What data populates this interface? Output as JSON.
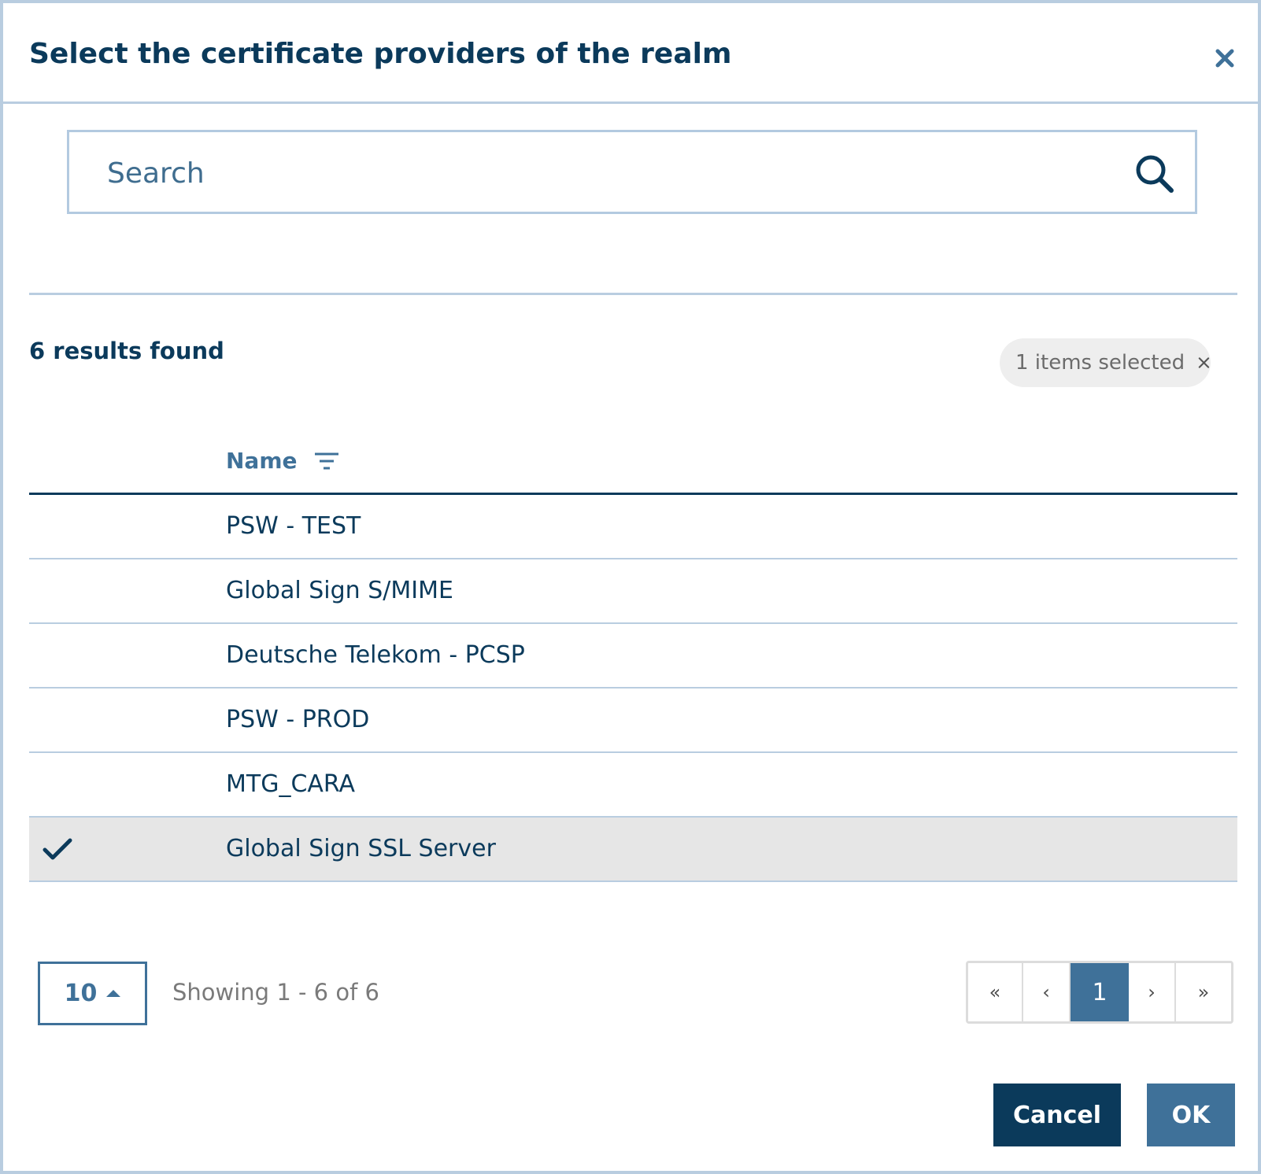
{
  "dialog": {
    "title": "Select the certificate providers of the realm"
  },
  "search": {
    "placeholder": "Search",
    "value": ""
  },
  "results": {
    "count_label": "6 results found",
    "selected_label": "1 items selected"
  },
  "table": {
    "column_name": "Name",
    "rows": [
      {
        "name": "PSW - TEST",
        "selected": false
      },
      {
        "name": "Global Sign S/MIME",
        "selected": false
      },
      {
        "name": "Deutsche Telekom - PCSP",
        "selected": false
      },
      {
        "name": "PSW - PROD",
        "selected": false
      },
      {
        "name": "MTG_CARA",
        "selected": false
      },
      {
        "name": "Global Sign SSL Server",
        "selected": true
      }
    ]
  },
  "pagination": {
    "page_size": "10",
    "showing": "Showing 1 - 6 of 6",
    "first": "«",
    "prev": "‹",
    "current_page": "1",
    "next": "›",
    "last": "»"
  },
  "buttons": {
    "cancel": "Cancel",
    "ok": "OK"
  },
  "colors": {
    "primary": "#0b3a5b",
    "accent": "#3f7199",
    "border": "#b9cde0",
    "selected_row": "#e6e6e6"
  }
}
